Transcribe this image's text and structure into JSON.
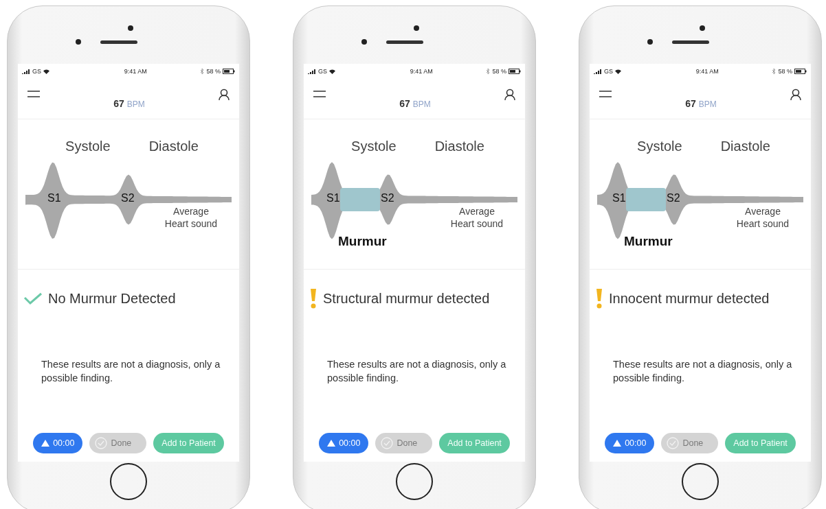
{
  "phones": [
    {
      "status": {
        "carrier": "GS",
        "time": "9:41 AM",
        "battery": "58 %"
      },
      "bpm": "67",
      "bpm_unit": "BPM",
      "systole": "Systole",
      "diastole": "Diastole",
      "s1": "S1",
      "s2": "S2",
      "average": "Average Heart sound",
      "result": {
        "kind": "normal",
        "text": "No Murmur Detected"
      },
      "disclaimer": "These results are not a diagnosis, only a possible finding.",
      "timer": "00:00",
      "done": {
        "label": "Done",
        "disabled": true
      },
      "add": "Add to Patient"
    },
    {
      "status": {
        "carrier": "GS",
        "time": "9:41 AM",
        "battery": "58 %"
      },
      "bpm": "67",
      "bpm_unit": "BPM",
      "systole": "Systole",
      "diastole": "Diastole",
      "s1": "S1",
      "s2": "S2",
      "murmur": "Murmur",
      "average": "Average Heart sound",
      "result": {
        "kind": "warning",
        "text": "Structural murmur detected"
      },
      "disclaimer": "These results are not a diagnosis, only a possible finding.",
      "timer": "00:00",
      "done": {
        "label": "Done",
        "disabled": true
      },
      "add": "Add to Patient"
    },
    {
      "status": {
        "carrier": "GS",
        "time": "9:41 AM",
        "battery": "58 %"
      },
      "bpm": "67",
      "bpm_unit": "BPM",
      "systole": "Systole",
      "diastole": "Diastole",
      "s1": "S1",
      "s2": "S2",
      "murmur": "Murmur",
      "average": "Average Heart sound",
      "result": {
        "kind": "warning",
        "text": "Innocent murmur detected"
      },
      "disclaimer": "These results are not a diagnosis, only a possible finding.",
      "timer": "00:00",
      "done": {
        "label": "Done",
        "disabled": true
      },
      "add": "Add to Patient"
    }
  ]
}
